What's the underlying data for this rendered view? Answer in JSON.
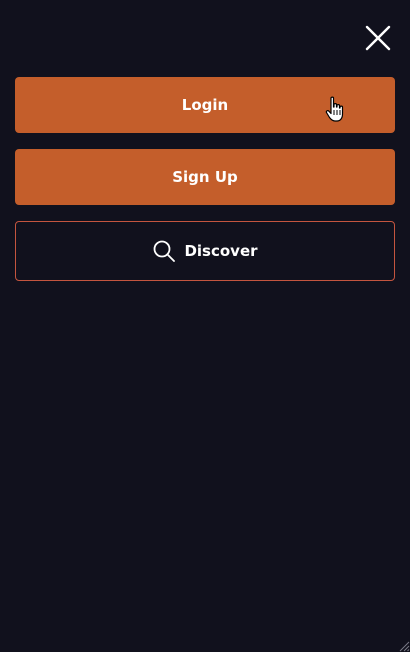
{
  "menu": {
    "close_icon": "close-icon",
    "login_label": "Login",
    "signup_label": "Sign Up",
    "discover_label": "Discover",
    "discover_icon": "search-icon"
  },
  "colors": {
    "background": "#11111d",
    "primary_button": "#c45e2b",
    "outline_border": "#c4553f",
    "text": "#ffffff"
  }
}
